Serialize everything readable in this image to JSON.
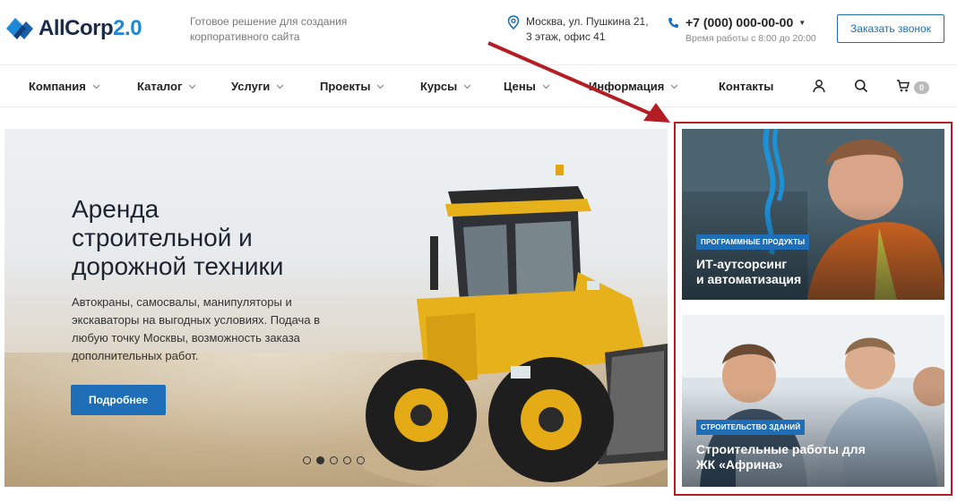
{
  "header": {
    "logo": {
      "name": "AllCorp",
      "version": "2.0"
    },
    "tagline": "Готовое решение для создания корпоративного сайта",
    "address": {
      "line1": "Москва, ул. Пушкина 21,",
      "line2": "3 этаж, офис 41",
      "icon": "map-pin-icon"
    },
    "phone": {
      "number": "+7 (000) 000-00-00",
      "hours": "Время работы с 8:00 до 20:00",
      "icon": "phone-icon"
    },
    "callback_label": "Заказать звонок"
  },
  "nav": {
    "items": [
      {
        "label": "Компания",
        "dropdown": true
      },
      {
        "label": "Каталог",
        "dropdown": true
      },
      {
        "label": "Услуги",
        "dropdown": true
      },
      {
        "label": "Проекты",
        "dropdown": true
      },
      {
        "label": "Курсы",
        "dropdown": true
      },
      {
        "label": "Цены",
        "dropdown": true
      },
      {
        "label": "Информация",
        "dropdown": true
      },
      {
        "label": "Контакты",
        "dropdown": false
      }
    ],
    "icons": [
      "user-icon",
      "search-icon",
      "cart-icon"
    ],
    "cart_count": "0"
  },
  "hero": {
    "title_lines": [
      "Аренда",
      "строительной и",
      "дорожной техники"
    ],
    "description": "Автокраны, самосвалы, манипуляторы и экскаваторы на выгодных условиях. Подача в любую точку Москвы, возможность заказа дополнительных работ.",
    "button_label": "Подробнее",
    "slides_total": 5,
    "active_slide": 2
  },
  "side_cards": [
    {
      "tag": "Программные продукты",
      "title_lines": [
        "ИТ-аутсорсинг",
        "и автоматизация"
      ]
    },
    {
      "tag": "Строительство зданий",
      "title_lines": [
        "Строительные работы для",
        "ЖК «Африна»"
      ]
    }
  ],
  "colors": {
    "accent": "#1e6fb8",
    "highlight": "#b31d23",
    "dark": "#1a2b4a"
  }
}
